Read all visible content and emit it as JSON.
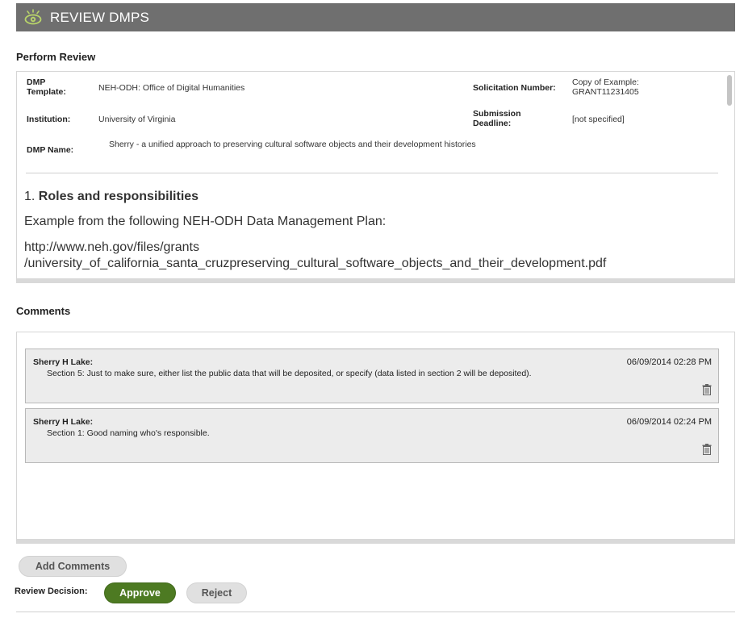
{
  "header": {
    "title": "REVIEW DMPS",
    "icon": "eye-icon",
    "background": "#6f6f6f"
  },
  "perform_review": {
    "label": "Perform Review",
    "dmp_template_label": "DMP\nTemplate:",
    "dmp_template_value": "NEH-ODH: Office of Digital Humanities",
    "institution_label": "Institution:",
    "institution_value": "University of Virginia",
    "dmp_name_label": "DMP Name:",
    "dmp_name_value": "Sherry - a unified approach to preserving cultural software objects and their development histories",
    "solicitation_label": "Solicitation Number:",
    "solicitation_value": "Copy of Example:\nGRANT11231405",
    "deadline_label": "Submission\nDeadline:",
    "deadline_value": "[not specified]",
    "question_number": "1.",
    "question_title": "Roles and responsibilities",
    "question_line1": "Example from the following NEH-ODH Data Management Plan:",
    "question_line2": "http://www.neh.gov/files/grants",
    "question_line3": "/university_of_california_santa_cruzpreserving_cultural_software_objects_and_their_development.pdf"
  },
  "comments": {
    "label": "Comments",
    "items": [
      {
        "author": "Sherry H Lake:",
        "date": "06/09/2014 02:28 PM",
        "text": "Section 5: Just to make sure, either list the public data that will be deposited, or specify (data listed in section 2 will be deposited)."
      },
      {
        "author": "Sherry H Lake:",
        "date": "06/09/2014 02:24 PM",
        "text": "Section 1: Good naming who's responsible."
      }
    ]
  },
  "actions": {
    "add_comments_label": "Add Comments",
    "review_decision_label": "Review Decision:",
    "approve_label": "Approve",
    "reject_label": "Reject",
    "approve_color": "#4d7a22"
  }
}
